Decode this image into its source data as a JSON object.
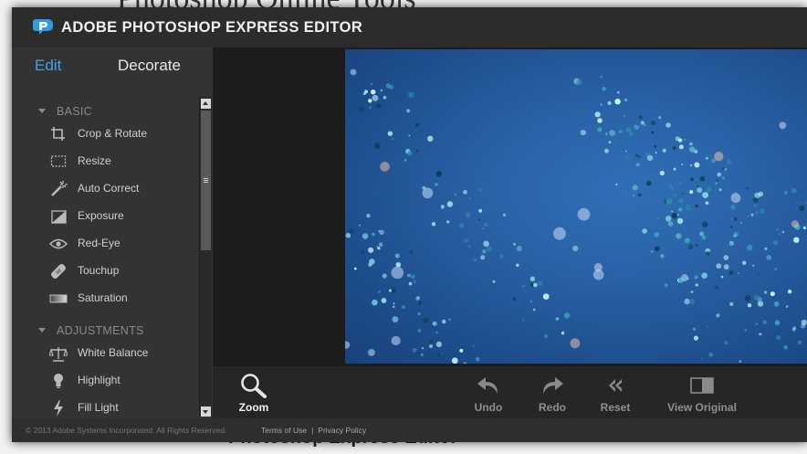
{
  "window": {
    "title": "ADOBE PHOTOSHOP EXPRESS EDITOR"
  },
  "background_page": {
    "heading_top": "Photoshop Online Tools",
    "heading_bottom": "Photoshop Express Editor"
  },
  "tabs": {
    "edit": "Edit",
    "decorate": "Decorate"
  },
  "sections": [
    {
      "label": "BASIC",
      "items": [
        {
          "label": "Crop & Rotate",
          "icon": "crop-icon"
        },
        {
          "label": "Resize",
          "icon": "resize-icon"
        },
        {
          "label": "Auto Correct",
          "icon": "magic-wand-icon"
        },
        {
          "label": "Exposure",
          "icon": "exposure-icon"
        },
        {
          "label": "Red-Eye",
          "icon": "eye-icon"
        },
        {
          "label": "Touchup",
          "icon": "bandage-icon"
        },
        {
          "label": "Saturation",
          "icon": "saturation-icon"
        }
      ]
    },
    {
      "label": "ADJUSTMENTS",
      "items": [
        {
          "label": "White Balance",
          "icon": "balance-scale-icon"
        },
        {
          "label": "Highlight",
          "icon": "lightbulb-icon"
        },
        {
          "label": "Fill Light",
          "icon": "lightning-icon"
        }
      ]
    }
  ],
  "toolbar": {
    "zoom": "Zoom",
    "undo": "Undo",
    "redo": "Redo",
    "reset": "Reset",
    "view_original": "View Original"
  },
  "footer": {
    "copyright": "© 2013 Adobe Systems Incorporated. All Rights Reserved.",
    "terms": "Terms of Use",
    "separator": "|",
    "privacy": "Privacy Policy"
  },
  "colors": {
    "accent": "#3fa3e6",
    "panel": "#333333",
    "photo_blue": "#2a62a6"
  }
}
